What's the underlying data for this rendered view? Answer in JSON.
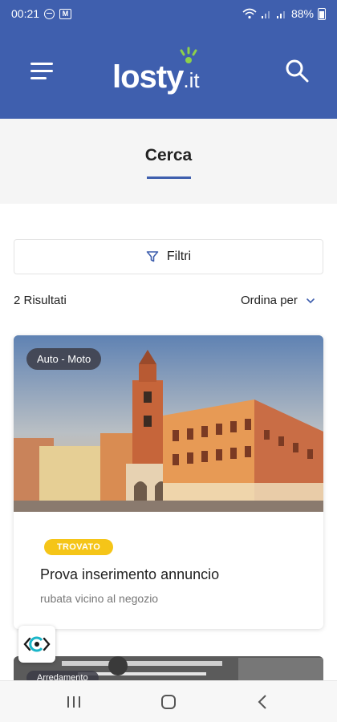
{
  "status_bar": {
    "time": "00:21",
    "badge": "M",
    "battery": "88%",
    "icons": [
      "dnd-icon",
      "gmail-icon",
      "wifi-icon",
      "signal-icon",
      "signal-icon",
      "battery-icon"
    ]
  },
  "header": {
    "logo_word": "losty",
    "logo_tld": ".it",
    "menu_icon": "hamburger-menu-icon",
    "search_icon": "search-icon",
    "accent": "#3f5fae",
    "logo_accent": "#8dd14a"
  },
  "page": {
    "title": "Cerca"
  },
  "filters": {
    "label": "Filtri",
    "icon": "filter-icon"
  },
  "results": {
    "count_label": "2 Risultati",
    "sort_label": "Ordina per",
    "sort_icon": "chevron-down-icon"
  },
  "cards": [
    {
      "category": "Auto - Moto",
      "status": "TROVATO",
      "status_color": "#f5c518",
      "title": "Prova inserimento annuncio",
      "description": "rubata vicino al negozio"
    },
    {
      "category": "Arredamento"
    }
  ],
  "nav_bar": {
    "buttons": [
      "recent-apps-icon",
      "home-icon",
      "back-icon"
    ]
  }
}
